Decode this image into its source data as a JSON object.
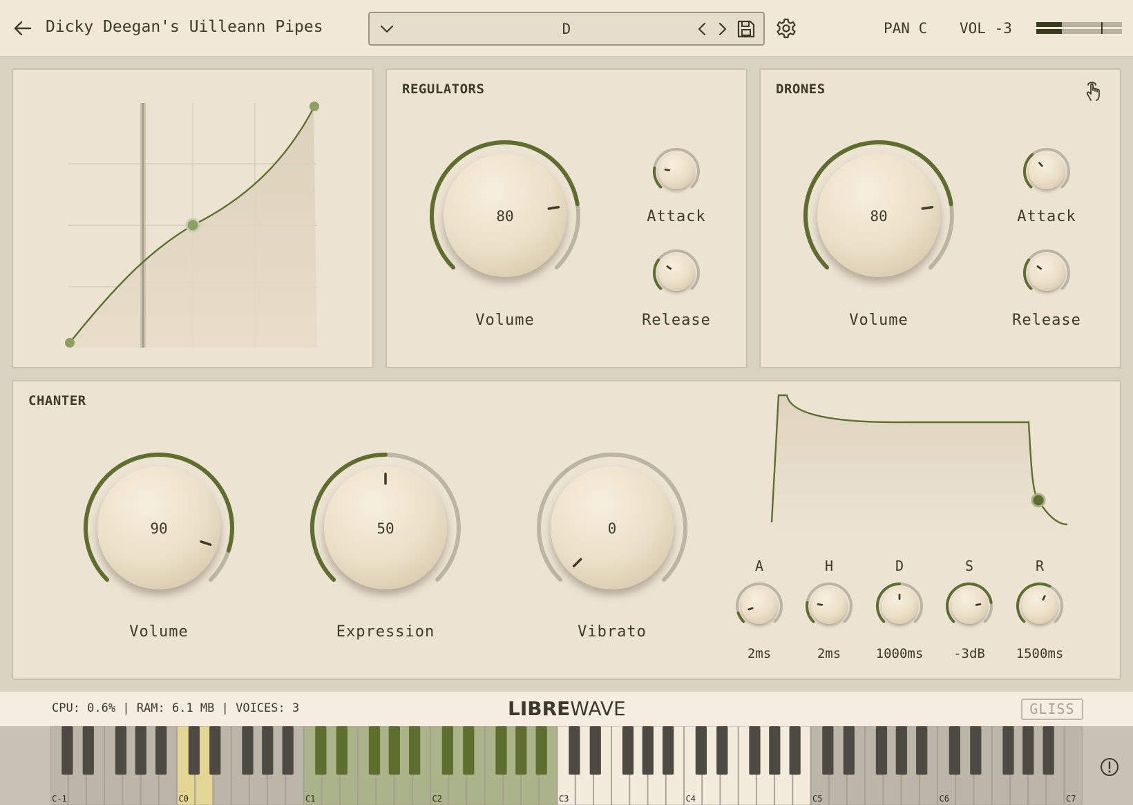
{
  "header": {
    "title": "Dicky Deegan's Uilleann Pipes",
    "preset": "D",
    "pan": "PAN C",
    "vol": "VOL -3",
    "meter_levels": [
      0.3,
      0.3
    ]
  },
  "regulators": {
    "title": "REGULATORS",
    "volume": {
      "label": "Volume",
      "value": "80",
      "level": 0.8
    },
    "attack": {
      "label": "Attack",
      "level": 0.2
    },
    "release": {
      "label": "Release",
      "level": 0.3
    }
  },
  "drones": {
    "title": "DRONES",
    "volume": {
      "label": "Volume",
      "value": "80",
      "level": 0.8
    },
    "attack": {
      "label": "Attack",
      "level": 0.35
    },
    "release": {
      "label": "Release",
      "level": 0.3
    }
  },
  "chanter": {
    "title": "CHANTER",
    "volume": {
      "label": "Volume",
      "value": "90",
      "level": 0.9
    },
    "expression": {
      "label": "Expression",
      "value": "50",
      "level": 0.5
    },
    "vibrato": {
      "label": "Vibrato",
      "value": "0",
      "level": 0.0
    },
    "envelope": [
      {
        "label": "A",
        "value": "2ms",
        "level": 0.1
      },
      {
        "label": "H",
        "value": "2ms",
        "level": 0.2
      },
      {
        "label": "D",
        "value": "1000ms",
        "level": 0.5
      },
      {
        "label": "S",
        "value": "-3dB",
        "level": 0.8
      },
      {
        "label": "R",
        "value": "1500ms",
        "level": 0.6
      }
    ]
  },
  "footer": {
    "stats": "CPU: 0.6% | RAM: 6.1 MB | VOICES: 3",
    "logo_bold": "LIBRE",
    "logo_light": "WAVE",
    "gliss": "GLISS"
  },
  "keyboard": {
    "octave_labels": [
      "C-1",
      "C0",
      "C1",
      "C2",
      "C3",
      "C4",
      "C5",
      "C6",
      "C7"
    ]
  },
  "colors": {
    "accent": "#5e6e2e",
    "track": "#bcb5a5",
    "panel": "#ece3d3"
  }
}
